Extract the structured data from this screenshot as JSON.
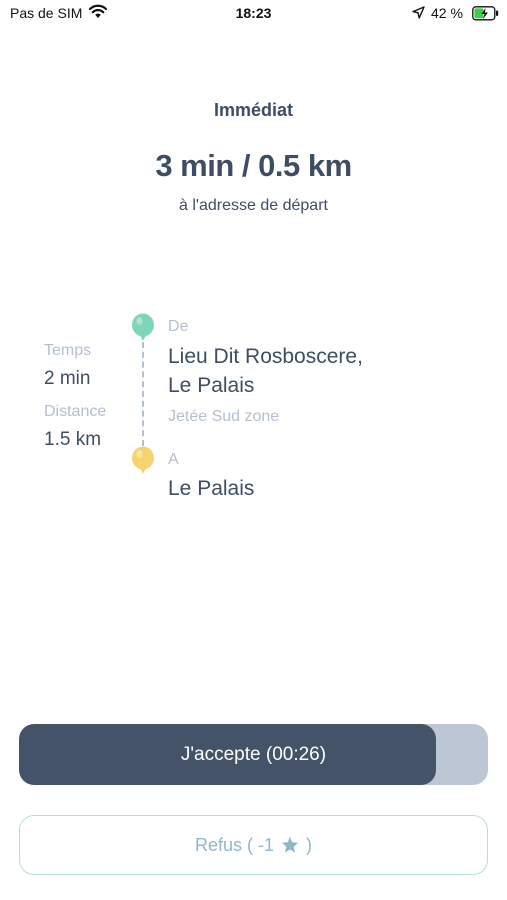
{
  "status_bar": {
    "carrier": "Pas de SIM",
    "time": "18:23",
    "battery_percent": "42 %"
  },
  "header": {
    "ride_type": "Immédiat",
    "eta": "3 min / 0.5 km",
    "eta_subtitle": "à l'adresse de départ"
  },
  "trip_stats": {
    "time_label": "Temps",
    "time_value": "2 min",
    "distance_label": "Distance",
    "distance_value": "1.5 km"
  },
  "route": {
    "from_label": "De",
    "from_line1": "Lieu Dit Rosboscere,",
    "from_line2": "Le Palais",
    "from_detail": "Jetée Sud zone",
    "to_label": "A",
    "to_address": "Le Palais"
  },
  "actions": {
    "accept_label": "J'accepte (00:26)",
    "accept_progress": 0.89,
    "refuse_label_prefix": "Refus ( -1",
    "refuse_label_suffix": ")"
  },
  "colors": {
    "text_primary": "#3f4d63",
    "text_muted": "#b5c0cf",
    "pin_from": "#7fd6b6",
    "pin_to": "#f5d470",
    "accept_fill": "#445368",
    "accept_track": "#bcc6d5",
    "refuse_border": "#b6e0d8",
    "refuse_text": "#8fb7c8"
  },
  "icons": {
    "wifi": "wifi-icon",
    "location": "location-arrow-icon",
    "battery": "battery-charging-icon",
    "pin_from": "green-map-pin-icon",
    "pin_to": "yellow-map-pin-icon",
    "star": "star-icon"
  }
}
